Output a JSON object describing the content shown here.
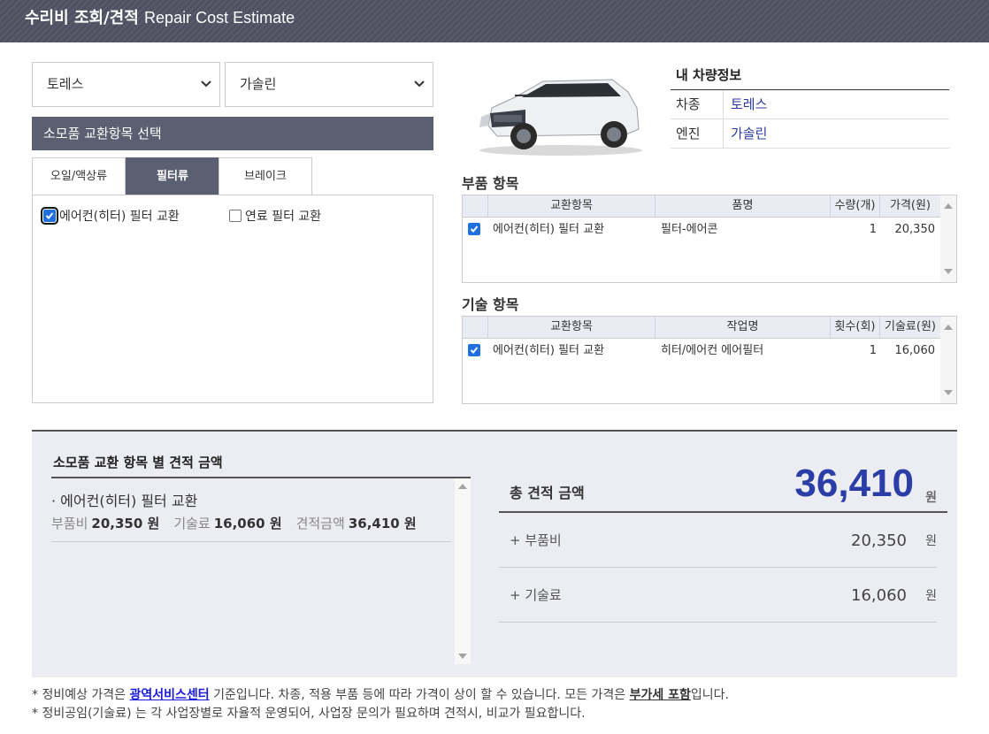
{
  "header": {
    "title_ko": "수리비 조회/견적",
    "title_en": "Repair Cost Estimate"
  },
  "selects": {
    "model": "토레스",
    "engine": "가솔린"
  },
  "consumables": {
    "section_title": "소모품 교환항목 선택",
    "tabs": [
      {
        "label": "오일/액상류",
        "active": false
      },
      {
        "label": "필터류",
        "active": true
      },
      {
        "label": "브레이크",
        "active": false
      }
    ],
    "items": [
      {
        "label": "에어컨(히터) 필터 교환",
        "checked": true
      },
      {
        "label": "연료 필터 교환",
        "checked": false
      }
    ]
  },
  "vehicle": {
    "title": "내 차량정보",
    "rows": [
      {
        "key": "차종",
        "value": "토레스"
      },
      {
        "key": "엔진",
        "value": "가솔린"
      }
    ]
  },
  "parts": {
    "title": "부품 항목",
    "columns": [
      "교환항목",
      "품명",
      "수량(개)",
      "가격(원)"
    ],
    "rows": [
      {
        "checked": true,
        "item": "에어컨(히터) 필터 교환",
        "name": "필터-에어콘",
        "qty": "1",
        "price": "20,350"
      }
    ]
  },
  "labor": {
    "title": "기술 항목",
    "columns": [
      "교환항목",
      "작업명",
      "횟수(회)",
      "기술료(원)"
    ],
    "rows": [
      {
        "checked": true,
        "item": "에어컨(히터) 필터 교환",
        "name": "히터/에어컨 에어필터",
        "qty": "1",
        "price": "16,060"
      }
    ]
  },
  "summary": {
    "title": "소모품 교환 항목 별 견적 금액",
    "item_name": "· 에어컨(히터) 필터 교환",
    "parts_label": "부품비",
    "parts_value": "20,350 원",
    "labor_label": "기술료",
    "labor_value": "16,060 원",
    "estimate_label": "견적금액",
    "estimate_value": "36,410 원",
    "total_label": "총 견적 금액",
    "total_value": "36,410",
    "unit": "원",
    "breakdown": [
      {
        "label": "+ 부품비",
        "value": "20,350",
        "unit": "원"
      },
      {
        "label": "+ 기술료",
        "value": "16,060",
        "unit": "원"
      }
    ]
  },
  "notes": {
    "line1_a": "* 정비예상 가격은 ",
    "line1_link": "광역서비스센터",
    "line1_b": " 기준입니다. 차종, 적용 부품 등에 따라 가격이 상이 할 수 있습니다. 모든 가격은 ",
    "line1_em": "부가세 포함",
    "line1_c": "입니다.",
    "line2": "* 정비공임(기술료) 는 각 사업장별로 자율적 운영되어, 사업장 문의가 필요하며 견적시, 비교가 필요합니다."
  },
  "colors": {
    "header_bg": "#4f5162",
    "section_bg": "#5b5f72",
    "accent_blue": "#2b3da6",
    "link": "#1a1adb",
    "summary_bg": "#ebedf2"
  }
}
